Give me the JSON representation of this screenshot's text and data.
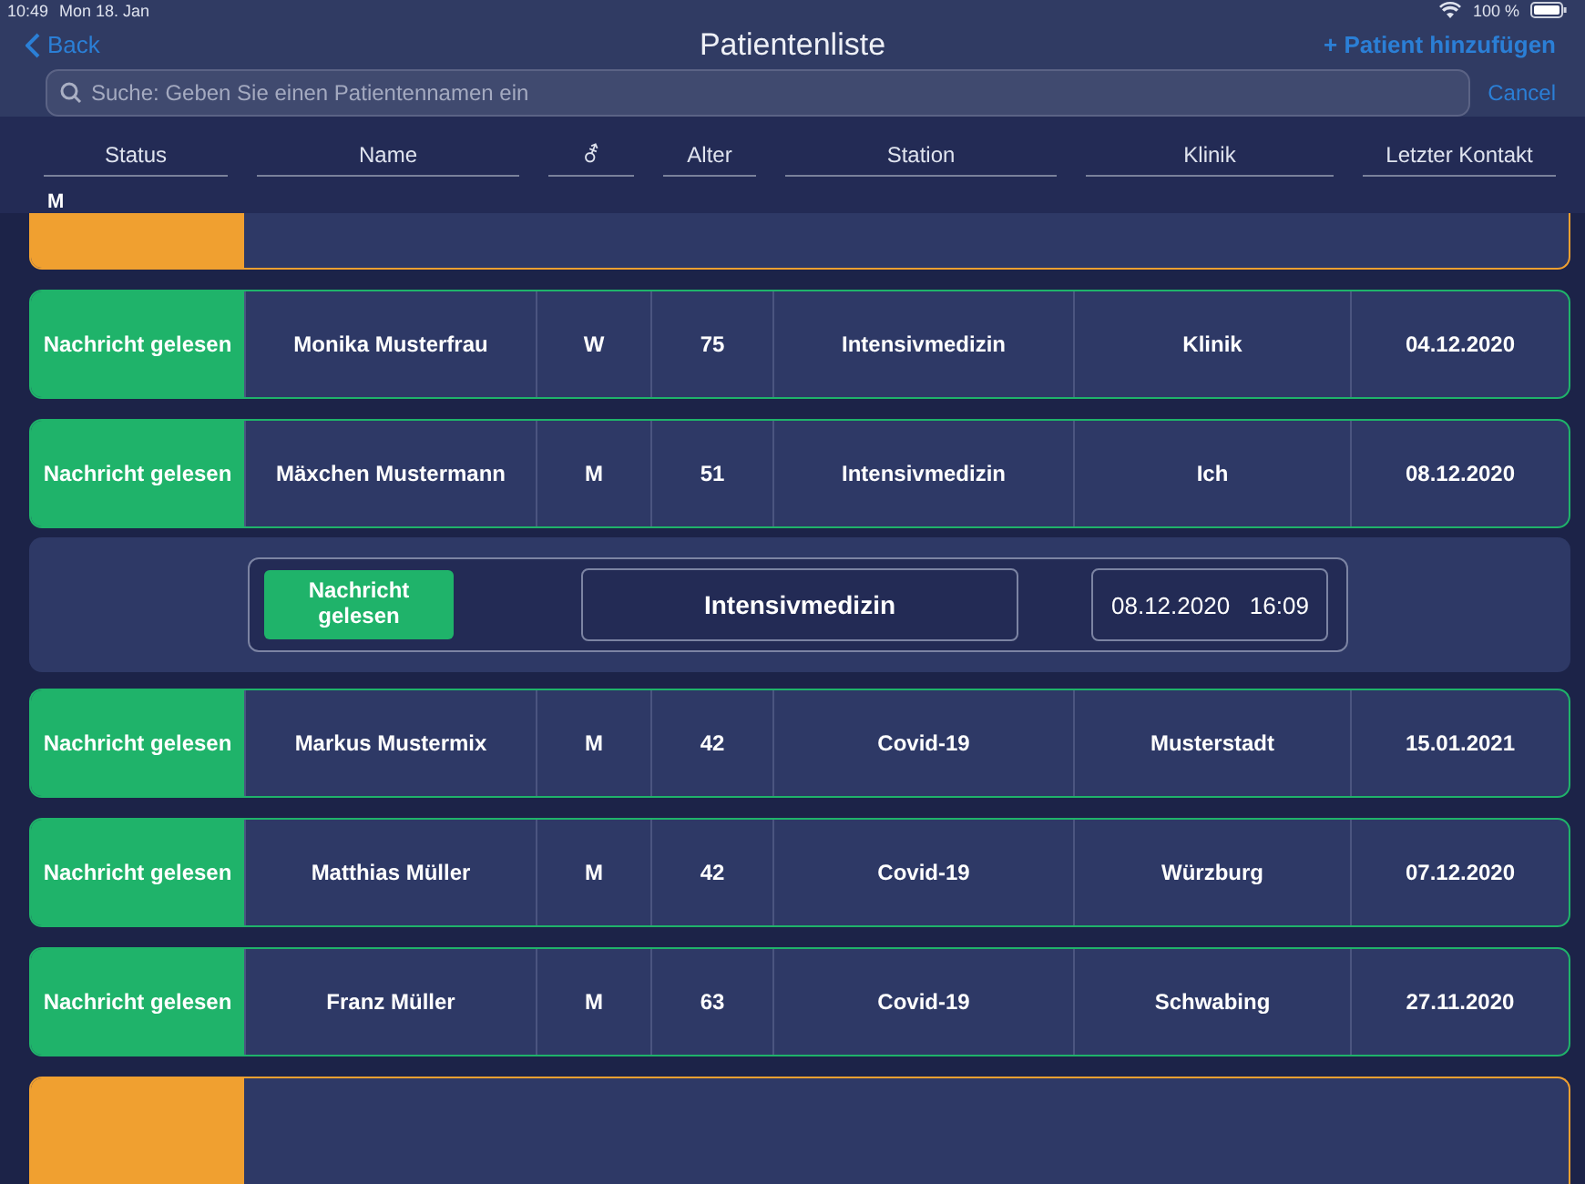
{
  "status_bar": {
    "time": "10:49",
    "date": "Mon 18. Jan",
    "battery": "100 %"
  },
  "nav": {
    "back": "Back",
    "title": "Patientenliste",
    "action": "+ Patient hinzufügen"
  },
  "search": {
    "placeholder": "Suche: Geben Sie einen Patientennamen ein",
    "cancel": "Cancel"
  },
  "table": {
    "columns": [
      "Status",
      "Name",
      "⚦",
      "Alter",
      "Station",
      "Klinik",
      "Letzter Kontakt"
    ],
    "section": "M",
    "rows": [
      {
        "kind": "partial",
        "color": "#f0a030"
      },
      {
        "kind": "patient",
        "color": "#1fb36a",
        "status": "Nachricht gelesen",
        "name": "Monika Musterfrau",
        "gender": "W",
        "age": "75",
        "station": "Intensivmedizin",
        "clinic": "Klinik",
        "last_contact": "04.12.2020"
      },
      {
        "kind": "patient",
        "color": "#1fb36a",
        "status": "Nachricht gelesen",
        "name": "Mäxchen Mustermann",
        "gender": "M",
        "age": "51",
        "station": "Intensivmedizin",
        "clinic": "Ich",
        "last_contact": "08.12.2020"
      },
      {
        "kind": "detail",
        "color": "#1fb36a",
        "message": "Nachricht gelesen",
        "ward": "Intensivmedizin",
        "date": "08.12.2020",
        "time": "16:09"
      },
      {
        "kind": "patient",
        "color": "#1fb36a",
        "status": "Nachricht gelesen",
        "name": "Markus Mustermix",
        "gender": "M",
        "age": "42",
        "station": "Covid-19",
        "clinic": "Musterstadt",
        "last_contact": "15.01.2021"
      },
      {
        "kind": "patient",
        "color": "#1fb36a",
        "status": "Nachricht gelesen",
        "name": "Matthias Müller",
        "gender": "M",
        "age": "42",
        "station": "Covid-19",
        "clinic": "Würzburg",
        "last_contact": "07.12.2020"
      },
      {
        "kind": "patient",
        "color": "#1fb36a",
        "status": "Nachricht gelesen",
        "name": "Franz Müller",
        "gender": "M",
        "age": "63",
        "station": "Covid-19",
        "clinic": "Schwabing",
        "last_contact": "27.11.2020"
      },
      {
        "kind": "bottom",
        "color": "#f0a030"
      }
    ]
  }
}
